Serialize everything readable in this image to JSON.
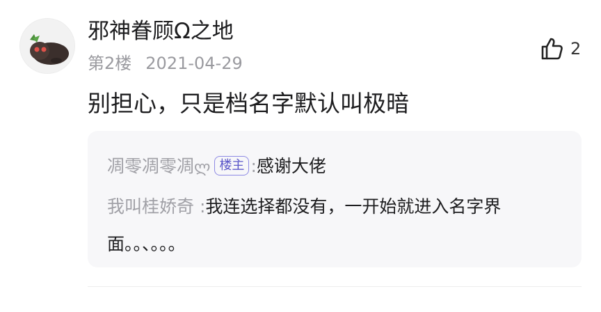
{
  "post": {
    "username": "邪神眷顾Ω之地",
    "floor": "第2楼",
    "date": "2021-04-29",
    "like_count": "2",
    "content": "别担心，只是档名字默认叫极暗"
  },
  "replies": [
    {
      "user": "凋零凋零凋",
      "decoration": "ლ",
      "badge": "楼主",
      "separator": ":",
      "text": "感谢大佬"
    },
    {
      "user": "我叫桂娇奇",
      "separator": " :",
      "text": "我连选择都没有，一开始就进入名字界面。。、。。。"
    }
  ],
  "icons": {
    "avatar": "avatar-image",
    "like": "thumbs-up-icon"
  },
  "colors": {
    "badge": "#5b57c9",
    "muted": "#9a9a9f",
    "reply_bg": "#f7f7f9"
  }
}
